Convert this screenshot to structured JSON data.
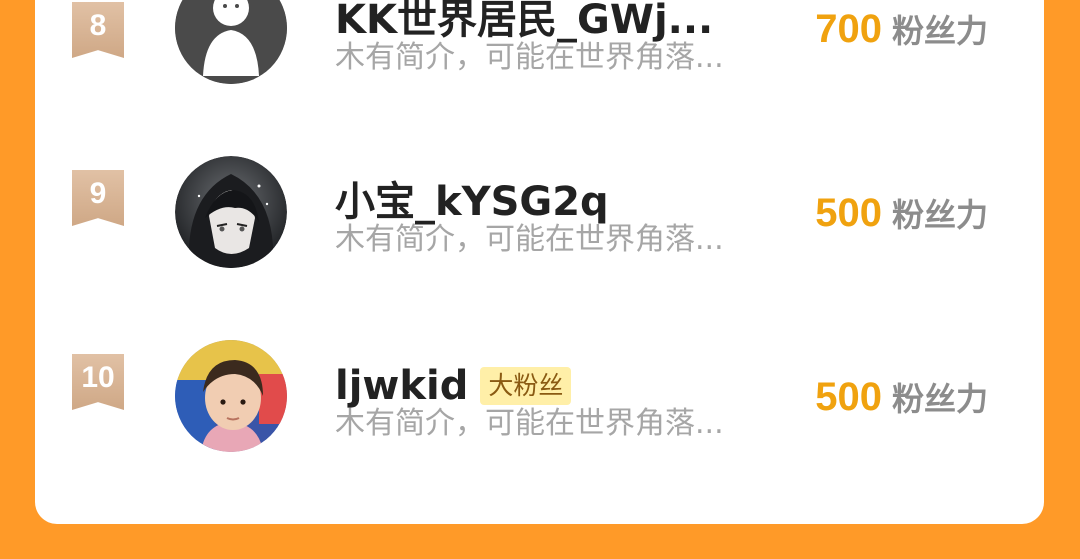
{
  "colors": {
    "background": "#FF9A28",
    "card": "#FFFFFF",
    "rank_badge": "#D8B497",
    "fan_power_value": "#F0A20F",
    "fan_tag_bg": "#FFEFA8"
  },
  "leaderboard": {
    "rows": [
      {
        "rank": "8",
        "name": "KK世界居民_GWj...",
        "tag": "",
        "bio": "木有简介，可能在世界角落...",
        "fan_power": "700",
        "fan_power_unit": "粉丝力",
        "avatar_icon": "default-person-avatar"
      },
      {
        "rank": "9",
        "name": "小宝_kYSG2q",
        "tag": "",
        "bio": "木有简介，可能在世界角落...",
        "fan_power": "500",
        "fan_power_unit": "粉丝力",
        "avatar_icon": "anime-hooded-boy-avatar"
      },
      {
        "rank": "10",
        "name": "ljwkid",
        "tag": "大粉丝",
        "bio": "木有简介，可能在世界角落...",
        "fan_power": "500",
        "fan_power_unit": "粉丝力",
        "avatar_icon": "child-photo-avatar"
      }
    ]
  }
}
